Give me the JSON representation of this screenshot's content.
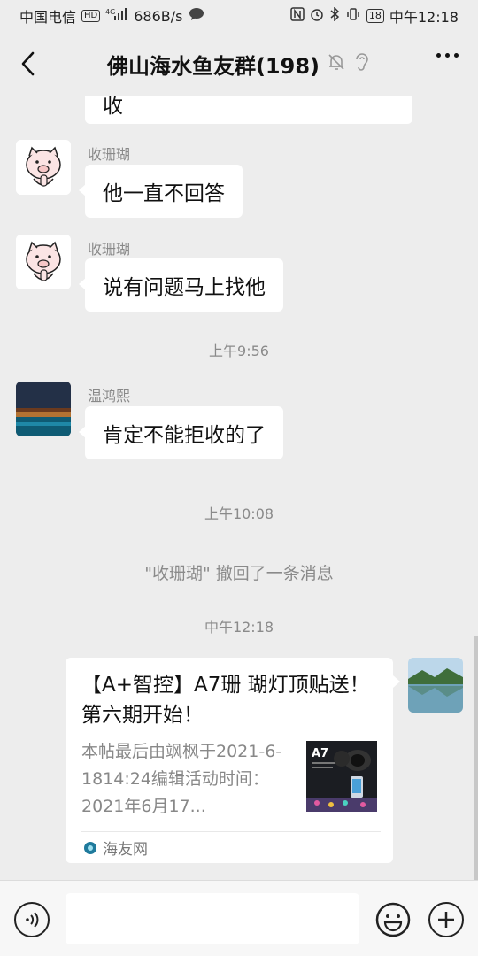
{
  "status_bar": {
    "carrier": "中国电信",
    "hd_badge": "HD",
    "net_type": "4G",
    "speed": "686B/s",
    "battery": "18",
    "time": "中午12:18"
  },
  "header": {
    "title": "佛山海水鱼友群(198)"
  },
  "messages": [
    {
      "type": "text",
      "sender": "",
      "text": "收"
    },
    {
      "type": "text",
      "sender": "收珊瑚",
      "text": "他一直不回答"
    },
    {
      "type": "text",
      "sender": "收珊瑚",
      "text": "说有问题马上找他"
    },
    {
      "type": "time",
      "text": "上午9:56"
    },
    {
      "type": "text",
      "sender": "温鸿熙",
      "text": "肯定不能拒收的了"
    },
    {
      "type": "time",
      "text": "上午10:08"
    },
    {
      "type": "system",
      "text": "\"收珊瑚\" 撤回了一条消息"
    },
    {
      "type": "time",
      "text": "中午12:18"
    }
  ],
  "card": {
    "title": "【A+智控】A7珊 瑚灯顶贴送！ 第六期开始！",
    "description": "本帖最后由飒枫于2021-6-1814:24编辑活动时间：2021年6月17...",
    "thumb_label": "A7",
    "source": "海友网"
  },
  "icons": {
    "back": "back-arrow-icon",
    "mute": "mute-bell-icon",
    "ear": "ear-icon",
    "more": "more-dots-icon",
    "voice": "voice-icon",
    "emoji": "emoji-icon",
    "plus": "plus-icon",
    "source_logo": "source-logo-icon"
  }
}
